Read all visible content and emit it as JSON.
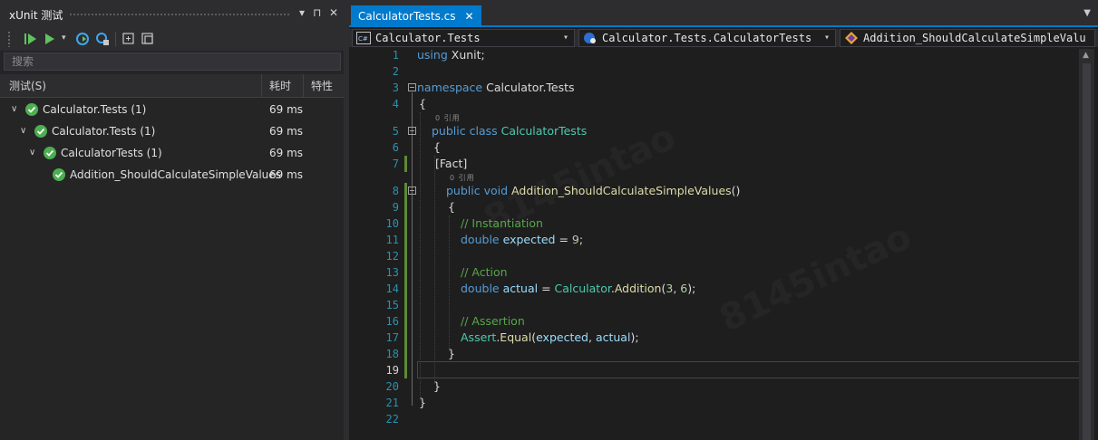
{
  "test_explorer": {
    "title": "xUnit 测试",
    "title_buttons": [
      "▾",
      "⊓",
      "✕"
    ],
    "search_placeholder": "搜索",
    "columns": {
      "test": "测试(S)",
      "duration": "耗时",
      "traits": "特性"
    },
    "rows": [
      {
        "name": "Calculator.Tests (1)",
        "duration": "69 ms",
        "level": 0,
        "expandable": true
      },
      {
        "name": "Calculator.Tests (1)",
        "duration": "69 ms",
        "level": 1,
        "expandable": true
      },
      {
        "name": "CalculatorTests (1)",
        "duration": "69 ms",
        "level": 2,
        "expandable": true
      },
      {
        "name": "Addition_ShouldCalculateSimpleValues",
        "duration": "69 ms",
        "level": 3,
        "expandable": false
      }
    ],
    "status_color": "#4caf50"
  },
  "editor": {
    "tab_label": "CalculatorTests.cs",
    "tab_close": "✕",
    "nav": {
      "project": "Calculator.Tests",
      "type": "Calculator.Tests.CalculatorTests",
      "member": "Addition_ShouldCalculateSimpleValu"
    },
    "hint_text": "0 引用",
    "line_numbers": [
      "1",
      "2",
      "3",
      "4",
      "5",
      "6",
      "7",
      "8",
      "9",
      "10",
      "11",
      "12",
      "13",
      "14",
      "15",
      "16",
      "17",
      "18",
      "19",
      "20",
      "21",
      "22"
    ],
    "tokens": {
      "using": "using",
      "xunit": "Xunit;",
      "namespace": "namespace",
      "ns_name": "Calculator.Tests",
      "brace_open": "{",
      "brace_close": "}",
      "public": "public",
      "class": "class",
      "class_name": "CalculatorTests",
      "fact": "[Fact]",
      "void": "void",
      "method": "Addition_ShouldCalculateSimpleValues",
      "parens": "()",
      "c_inst": "// Instantiation",
      "double": "double",
      "expected": "expected",
      "eq9": " = ",
      "nine": "9",
      "semi": ";",
      "c_action": "// Action",
      "actual": "actual",
      "eq": " = ",
      "calc": "Calculator",
      "dot": ".",
      "addition": "Addition",
      "p_open": "(",
      "three": "3",
      "comma_sp": ", ",
      "six": "6",
      "p_close_semi": ");",
      "c_assert": "// Assertion",
      "assert": "Assert",
      "equal": "Equal"
    },
    "accent_color": "#007acc"
  }
}
